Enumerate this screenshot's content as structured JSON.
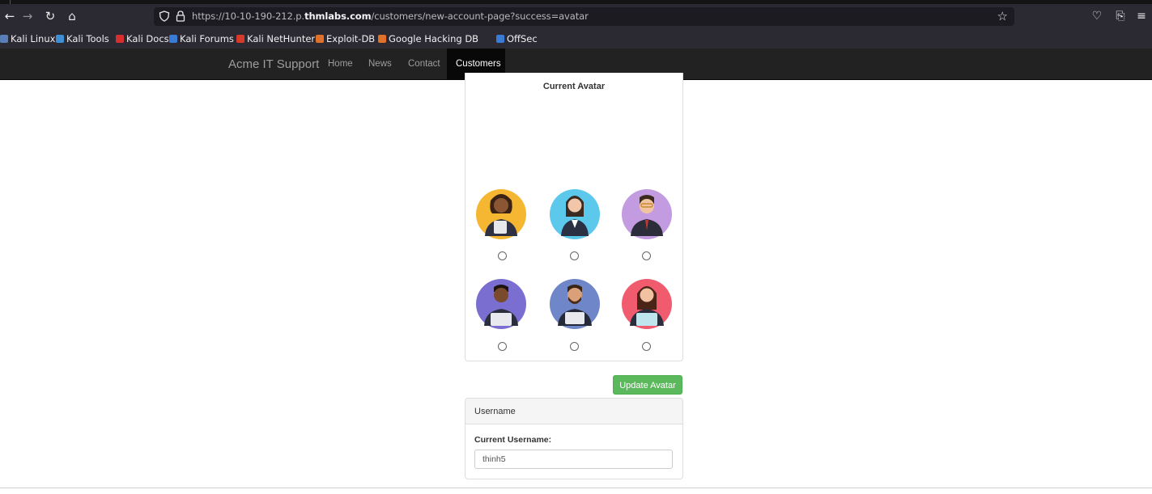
{
  "browser": {
    "url_prefix": "https://10-10-190-212.p.",
    "url_domain": "thmlabs.com",
    "url_path": "/customers/new-account-page?success=avatar",
    "icons": [
      "back-icon",
      "forward-icon",
      "reload-icon",
      "home-icon",
      "shield-icon",
      "lock-icon",
      "bookmark-star-icon",
      "pocket-icon",
      "extensions-icon",
      "menu-icon"
    ],
    "bookmarks": [
      {
        "label": "Kali Linux",
        "color": "#5a7fb8"
      },
      {
        "label": "Kali Tools",
        "color": "#3d8fd6"
      },
      {
        "label": "Kali Docs",
        "color": "#d62f2f"
      },
      {
        "label": "Kali Forums",
        "color": "#3a7bd5"
      },
      {
        "label": "Kali NetHunter",
        "color": "#d63a2a"
      },
      {
        "label": "Exploit-DB",
        "color": "#e0702a"
      },
      {
        "label": "Google Hacking DB",
        "color": "#e0702a"
      },
      {
        "label": "OffSec",
        "color": "#3a7bd5"
      }
    ]
  },
  "site": {
    "brand": "Acme IT Support",
    "nav": [
      "Home",
      "News",
      "Contact",
      "Customers"
    ],
    "active_nav": "Customers"
  },
  "avatar_section": {
    "title": "Current Avatar",
    "options": [
      {
        "name": "avatar-1",
        "bg": "#f5b731",
        "selected": false
      },
      {
        "name": "avatar-2",
        "bg": "#5bc8ec",
        "selected": false
      },
      {
        "name": "avatar-3",
        "bg": "#c39be0",
        "selected": false
      },
      {
        "name": "avatar-4",
        "bg": "#7a6fd1",
        "selected": false
      },
      {
        "name": "avatar-5",
        "bg": "#6f86c9",
        "selected": false
      },
      {
        "name": "avatar-6",
        "bg": "#f05c6e",
        "selected": false
      }
    ],
    "update_button": "Update Avatar"
  },
  "username_section": {
    "heading": "Username",
    "label": "Current Username:",
    "value": "thinh5"
  },
  "colors": {
    "success": "#5cb85c",
    "navbar": "#222222"
  }
}
